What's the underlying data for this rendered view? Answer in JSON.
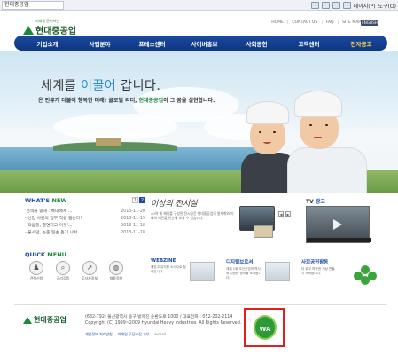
{
  "browser": {
    "tab_title": "현대중공업",
    "tools": [
      "페이지(P)",
      "도구(O)"
    ]
  },
  "header": {
    "logo_text": "현대중공업",
    "logo_tagline": "미래를 준비하는",
    "util_links": [
      "HOME",
      "CONTACT US",
      "FAQ",
      "SITE MAP"
    ],
    "language": "ENGLISH"
  },
  "nav": {
    "items": [
      {
        "label": "기업소개",
        "highlight": false
      },
      {
        "label": "사업분야",
        "highlight": false
      },
      {
        "label": "프레스센터",
        "highlight": false
      },
      {
        "label": "사이버홍보",
        "highlight": false
      },
      {
        "label": "사회공헌",
        "highlight": false
      },
      {
        "label": "고객센터",
        "highlight": false
      },
      {
        "label": "전자공고",
        "highlight": true
      }
    ]
  },
  "hero": {
    "title_before": "세계를 ",
    "title_accent": "이끌어",
    "title_after": " 갑니다.",
    "sub_before": "온 인류가 더불어 행복한 미래!  글로벌 리더, ",
    "sub_company": "현대중공업",
    "sub_after": "이 그 꿈을 실현합니다."
  },
  "news": {
    "title_left": "WHAT'S ",
    "title_accent": "NEW",
    "pages": [
      "1",
      "2"
    ],
    "items": [
      {
        "title": "'검색을 향해 : 특대배세 ...",
        "date": "2013-11-20"
      },
      {
        "title": "- 선입 사원의 업무 적응 돕는다!",
        "date": "2013-11-19"
      },
      {
        "title": "- 작음들, 결연처고 이웃'...",
        "date": "2013-11-18"
      },
      {
        "title": "- 불사던, 농촌 일손 돕기 나서...",
        "date": "2013-11-18"
      }
    ]
  },
  "promo": {
    "calligraphy": "이상의 전시실",
    "text": "40여 해 해외를 구성된 전시공간 현대중공업의 발자취와 미래의 비전을 한눈에 보실 수 있습니다."
  },
  "tvad": {
    "title_left": "TV ",
    "title_accent": "광고"
  },
  "quick": {
    "title_left": "QUICK ",
    "title_accent": "MENU",
    "items": [
      {
        "label": "견적신청",
        "icon": "person-icon",
        "glyph": "♟"
      },
      {
        "label": "공리검증",
        "icon": "search-doc-icon",
        "glyph": "⌕"
      },
      {
        "label": "투자자정보",
        "icon": "chart-icon",
        "glyph": "↗"
      },
      {
        "label": "채용정보",
        "icon": "globe-icon",
        "glyph": "◍"
      }
    ]
  },
  "features": [
    {
      "title": "WEBZINE",
      "text": "재밌고 유익한 소식으로 찾아갑니다."
    },
    {
      "title": "디지털브로셔",
      "text": "세계 1위 조선산업의 역사와 다양한 정보를 소개합니다."
    },
    {
      "title": "사회공헌활동",
      "text": "더 밝고 따뜻한 세상 만들기 노력합니다."
    }
  ],
  "footer": {
    "logo_text": "현대중공업",
    "address": "(682-792) 울산광역시 동구 방어진 순환도로 1000 / 대표전화 : 052-202-2114",
    "copyright": "Copyright (C) 1999~2009 Hyundai Heavy Industries. All Rights Reserved.",
    "links": [
      "개인정보 처리방침",
      "이메일 무단수집 거부",
      "e-mail"
    ],
    "award_text": "WA"
  }
}
